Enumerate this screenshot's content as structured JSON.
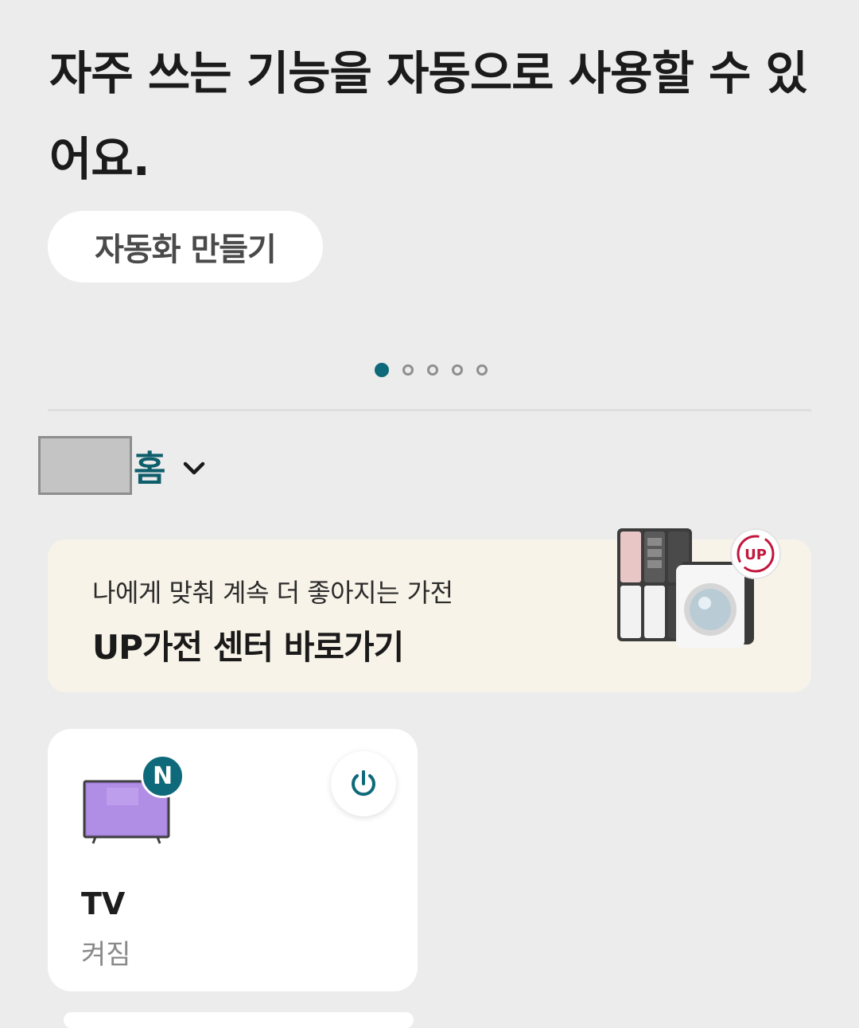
{
  "hero": {
    "title": "자주 쓰는 기능을 자동으로 사용할 수 있어요.",
    "button_label": "자동화 만들기"
  },
  "carousel": {
    "total_pages": 5,
    "active_page": 1,
    "active_color": "#0e6a7a"
  },
  "home": {
    "label": "홈",
    "dropdown_icon": "chevron-down-icon"
  },
  "banner": {
    "subtitle": "나에게 맞춰 계속 더 좋아지는 가전",
    "title": "UP가전 센터 바로가기",
    "badge_text": "UP",
    "background_color": "#f8f3e8"
  },
  "devices": [
    {
      "name": "TV",
      "status": "켜짐",
      "badge": "N",
      "icon": "tv-icon",
      "power_icon": "power-icon",
      "accent_color": "#0e6a7a"
    }
  ]
}
